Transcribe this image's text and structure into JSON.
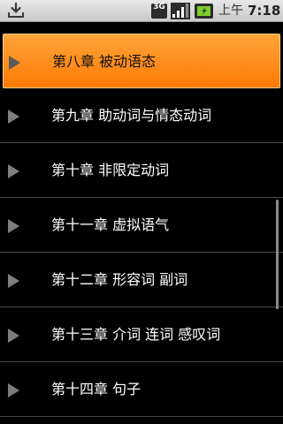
{
  "status_bar": {
    "network_type": "3G",
    "ampm": "上午",
    "time": "7:18",
    "icons": [
      "download-icon",
      "network-3g-icon",
      "signal-strength-icon",
      "battery-charging-icon"
    ]
  },
  "chapters": [
    {
      "label": "第八章 被动语态",
      "selected": true
    },
    {
      "label": "第九章 助动词与情态动词",
      "selected": false
    },
    {
      "label": "第十章 非限定动词",
      "selected": false
    },
    {
      "label": "第十一章 虚拟语气",
      "selected": false
    },
    {
      "label": "第十二章 形容词 副词",
      "selected": false
    },
    {
      "label": "第十三章 介词 连词 感叹词",
      "selected": false
    },
    {
      "label": "第十四章 句子",
      "selected": false
    }
  ],
  "colors": {
    "selected_background": "#ff8c1a",
    "background": "#000000",
    "text": "#ffffff",
    "divider": "#4a4a4a",
    "arrow": "#7d7d7d",
    "battery_green": "#7ccf2e"
  }
}
